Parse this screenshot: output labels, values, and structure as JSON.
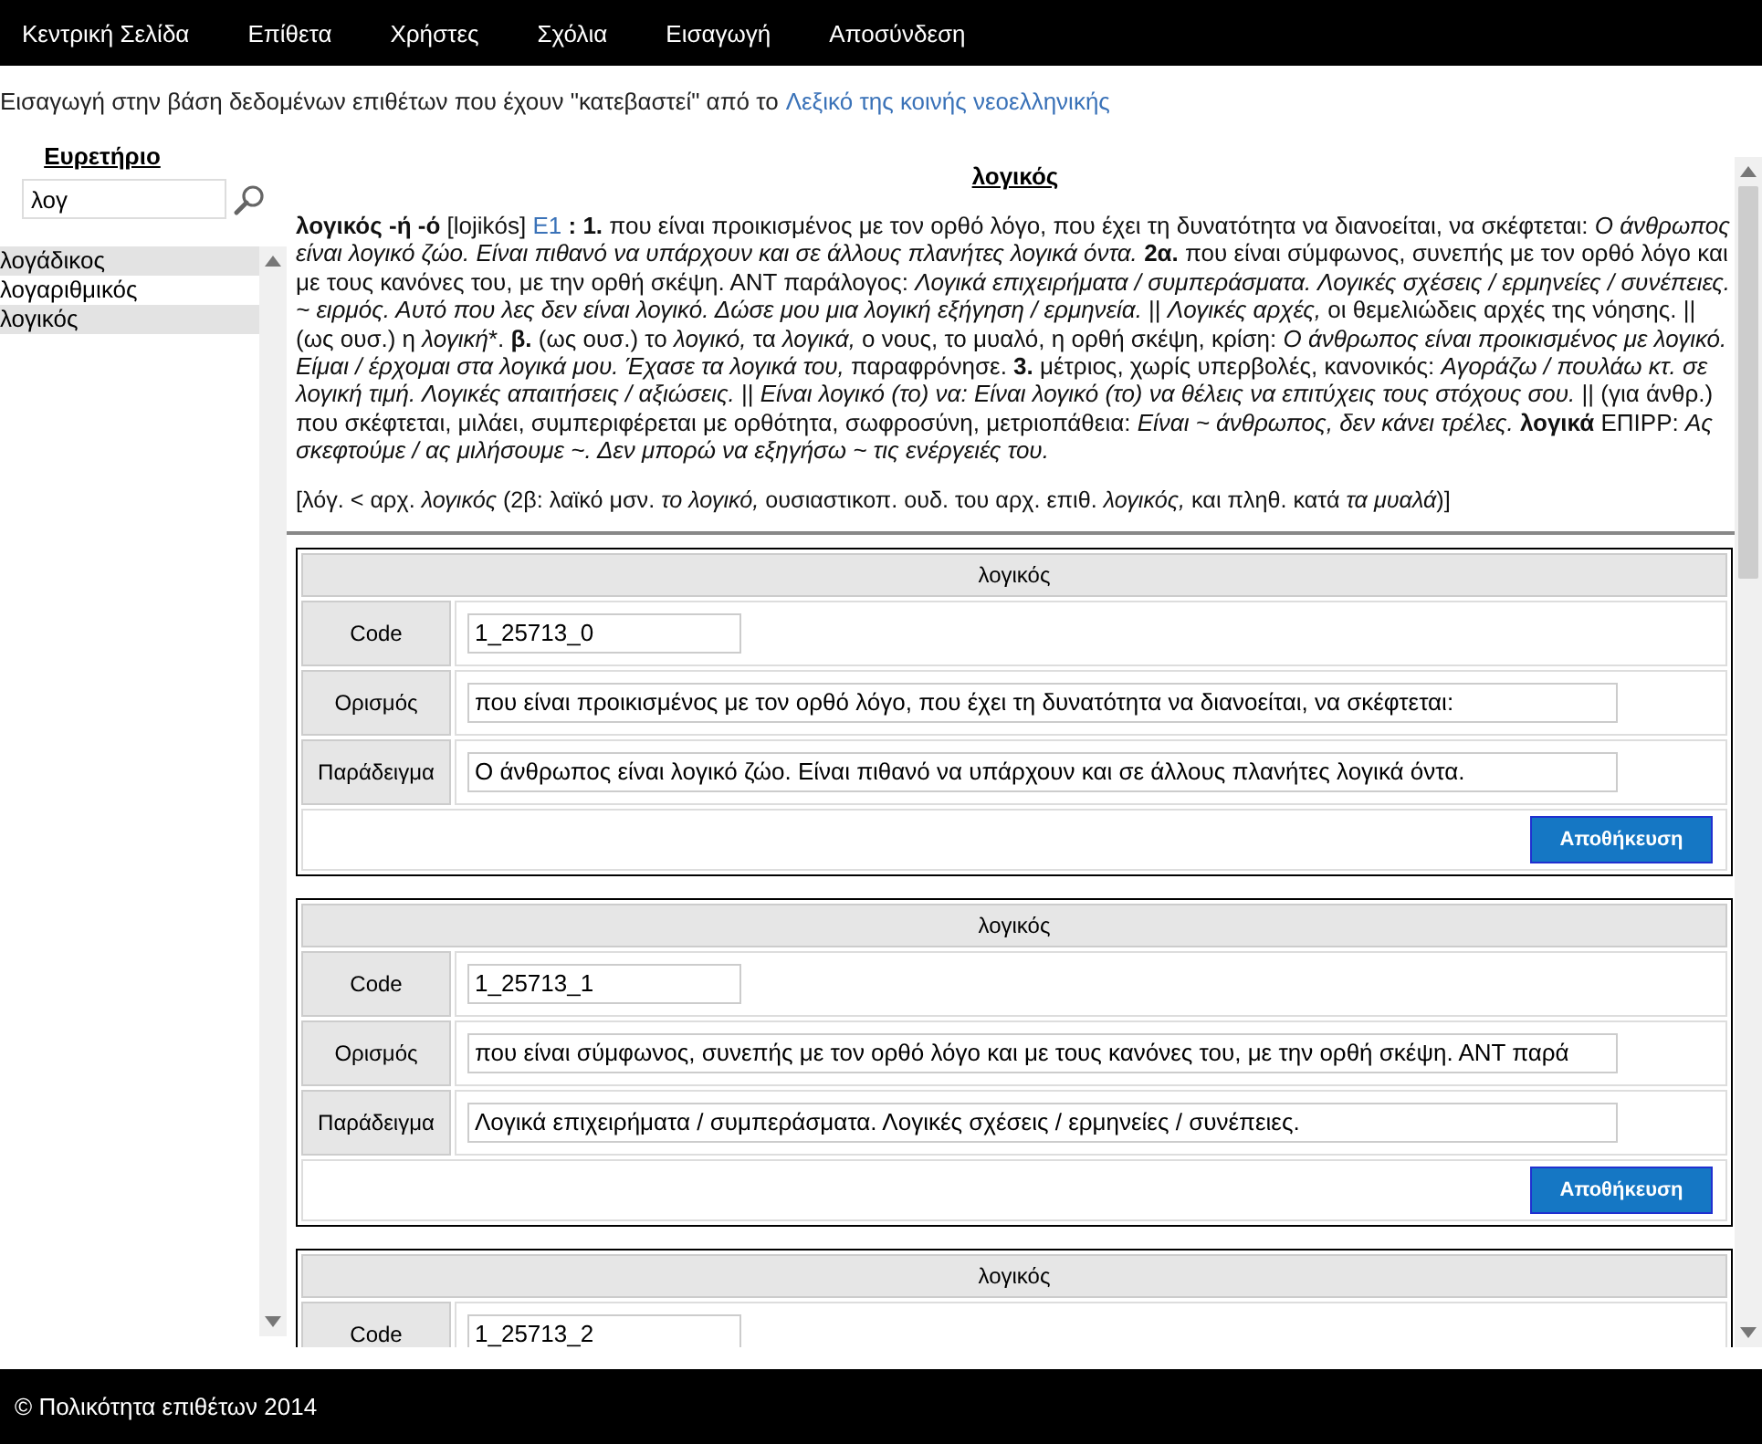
{
  "nav": [
    "Κεντρική Σελίδα",
    "Επίθετα",
    "Χρήστες",
    "Σχόλια",
    "Εισαγωγή",
    "Αποσύνδεση"
  ],
  "intro": {
    "text": "Εισαγωγή στην βάση δεδομένων επιθέτων που έχουν \"κατεβαστεί\" από το",
    "link": "Λεξικό της κοινής νεοελληνικής"
  },
  "index": {
    "title": "Ευρετήριο",
    "search_value": "λογ",
    "items": [
      {
        "label": "λογάδικος",
        "selected": true
      },
      {
        "label": "λογαριθμικός",
        "selected": false
      },
      {
        "label": "λογικός",
        "selected": true
      }
    ]
  },
  "entry": {
    "title": "λογικός",
    "lead": "**λογικός -ή -ό** [lojikós]",
    "link": "E1",
    "body": [
      {
        "kind": "rich",
        "text": "**: 1.** που είναι προικισμένος με τον ορθό λόγο, που έχει τη δυνατότητα να διανοείται, να σκέφτεται: *Ο άνθρωπος είναι λογικό ζώο. Είναι πιθανό να υπάρχουν και σε άλλους πλανήτες λογικά όντα.* **2α.** που είναι σύμφωνος, συνεπής με τον ορθό λόγο και με τους κανόνες του, με την ορθή σκέψη. ΑΝΤ παράλογος: *Λογικά επιχειρήματα / συμπεράσματα. Λογικές σχέσεις / ερμηνείες / συνέπειες. ~ ειρμός. Αυτό που λες δεν είναι λογικό. Δώσε μου μια λογική εξήγηση / ερμηνεία.* || *Λογικές αρχές,* οι θεμελιώδεις αρχές της νόησης. || (ως ουσ.) η *λογική*"
      },
      {
        "kind": "plain",
        "text": "*"
      },
      {
        "kind": "rich",
        "text": ". **β.** (ως ουσ.) το *λογικό,* τα *λογικά,* ο νους, το μυαλό, η ορθή σκέψη, κρίση: *Ο άνθρωπος είναι προικισμένος με λογικό. Είμαι / έρχομαι στα λογικά μου. Έχασε τα λογικά του,* παραφρόνησε. **3.** μέτριος, χωρίς υπερβολές, κανονικός: *Αγοράζω / πουλάω κτ. σε λογική τιμή. Λογικές απαιτήσεις / αξιώσεις.* || *Είναι λογικό (το) να: Είναι λογικό (το) να θέλεις να επιτύχεις τους στόχους σου.* || (για άνθρ.) που σκέφτεται, μιλάει, συμπεριφέρεται με ορθότητα, σωφροσύνη, μετριοπάθεια: *Είναι ~ άνθρωπος, δεν κάνει τρέλες.* **λογικά** ΕΠΙΡΡ: *Ας σκεφτούμε / ας μιλήσουμε ~. Δεν μπορώ να εξηγήσω ~ τις ενέργειές του.*"
      }
    ],
    "etymology": "[λόγ. < αρχ. *λογικός* (2β: λαϊκό μσν. *το λογικό,* ουσιαστικοπ. ουδ. του αρχ. επιθ. *λογικός,* και πληθ. κατά *τα μυαλά*)]"
  },
  "cards": [
    {
      "title": "λογικός",
      "fields": [
        {
          "label": "Code",
          "kind": "short",
          "value": "1_25713_0"
        },
        {
          "label": "Ορισμός",
          "kind": "long",
          "value": "που είναι προικισμένος με τον ορθό λόγο, που έχει τη δυνατότητα να διανοείται, να σκέφτεται:"
        },
        {
          "label": "Παράδειγμα",
          "kind": "long",
          "value": "Ο άνθρωπος είναι λογικό ζώο. Είναι πιθανό να υπάρχουν και σε άλλους πλανήτες λογικά όντα."
        }
      ],
      "button": "Αποθήκευση"
    },
    {
      "title": "λογικός",
      "fields": [
        {
          "label": "Code",
          "kind": "short",
          "value": "1_25713_1"
        },
        {
          "label": "Ορισμός",
          "kind": "long",
          "value": "που είναι σύμφωνος, συνεπής με τον ορθό λόγο και με τους κανόνες του, με την ορθή σκέψη. ΑΝΤ παρά"
        },
        {
          "label": "Παράδειγμα",
          "kind": "long",
          "value": "Λογικά επιχειρήματα / συμπεράσματα. Λογικές σχέσεις / ερμηνείες / συνέπειες."
        }
      ],
      "button": "Αποθήκευση"
    },
    {
      "title": "λογικός",
      "fields": [
        {
          "label": "Code",
          "kind": "short",
          "value": "1_25713_2"
        }
      ]
    }
  ],
  "footer": "© Πολικότητα επιθέτων 2014"
}
